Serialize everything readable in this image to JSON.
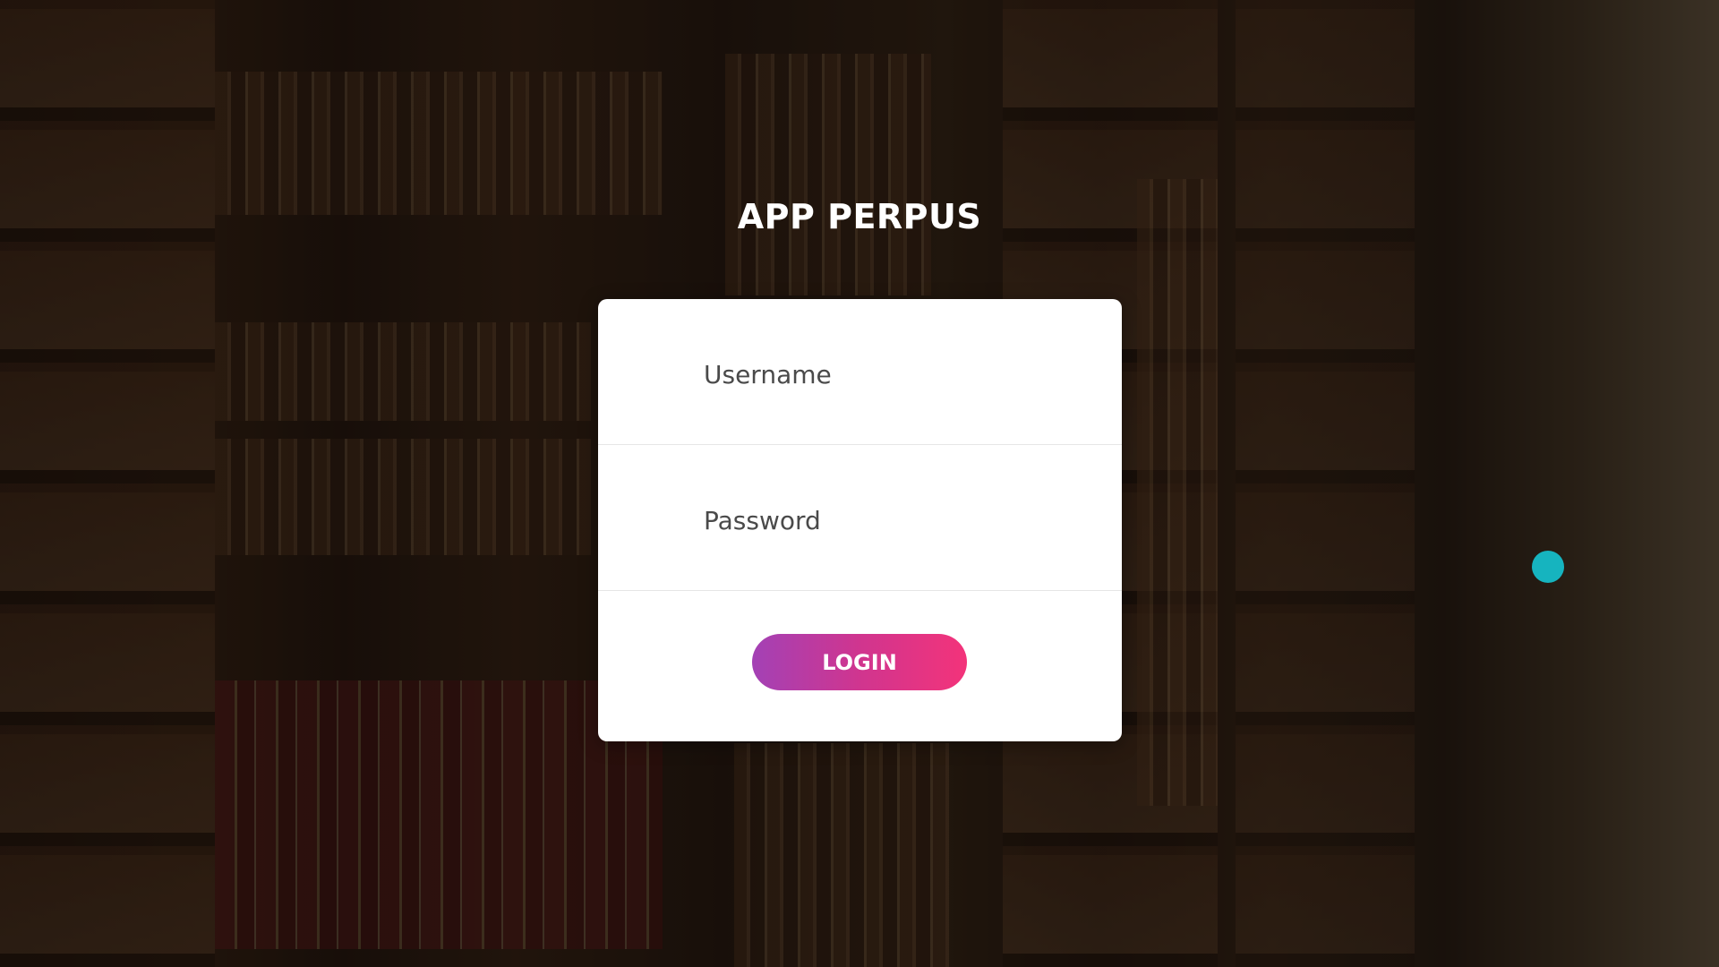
{
  "app": {
    "title": "APP PERPUS"
  },
  "login_form": {
    "username_placeholder": "Username",
    "username_value": "",
    "password_placeholder": "Password",
    "password_value": "",
    "submit_label": "LOGIN"
  },
  "colors": {
    "button_gradient_start": "#a341b5",
    "button_gradient_end": "#f3337a",
    "card_background": "#ffffff",
    "cursor_indicator": "#16b4bf"
  }
}
